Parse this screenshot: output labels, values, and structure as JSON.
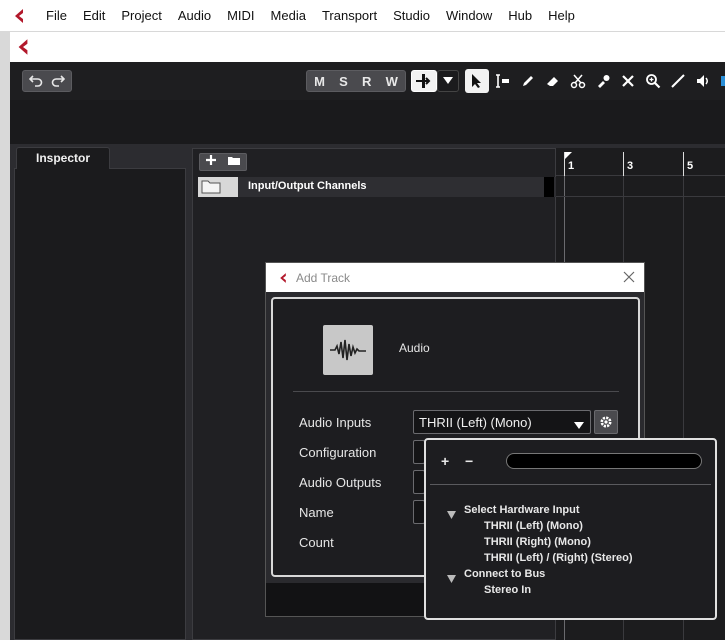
{
  "menubar": {
    "items": [
      "File",
      "Edit",
      "Project",
      "Audio",
      "MIDI",
      "Media",
      "Transport",
      "Studio",
      "Window",
      "Hub",
      "Help"
    ]
  },
  "toolbar": {
    "undo_icon": "undo-icon",
    "redo_icon": "redo-icon",
    "m_label": "M",
    "s_label": "S",
    "r_label": "R",
    "w_label": "W"
  },
  "inspector": {
    "tab_label": "Inspector"
  },
  "tracklist": {
    "folder_track_name": "Input/Output Channels"
  },
  "ruler": {
    "ticks": [
      "1",
      "3",
      "5"
    ]
  },
  "dialog": {
    "title": "Add Track",
    "track_type": "Audio",
    "audio_inputs_label": "Audio Inputs",
    "audio_inputs_value": "THRII (Left) (Mono)",
    "configuration_label": "Configuration",
    "audio_outputs_label": "Audio Outputs",
    "name_label": "Name",
    "count_label": "Count"
  },
  "popup": {
    "plus": "+",
    "minus": "−",
    "hardware_group": "Select Hardware Input",
    "hardware_items": [
      "THRII (Left) (Mono)",
      "THRII (Right) (Mono)",
      "THRII (Left) / (Right) (Stereo)"
    ],
    "bus_group": "Connect to Bus",
    "bus_items": [
      "Stereo In"
    ]
  },
  "colors": {
    "accent": "#b2182b",
    "dialog_bg": "#1d1d20",
    "panel_bg": "#2a2a2e"
  }
}
